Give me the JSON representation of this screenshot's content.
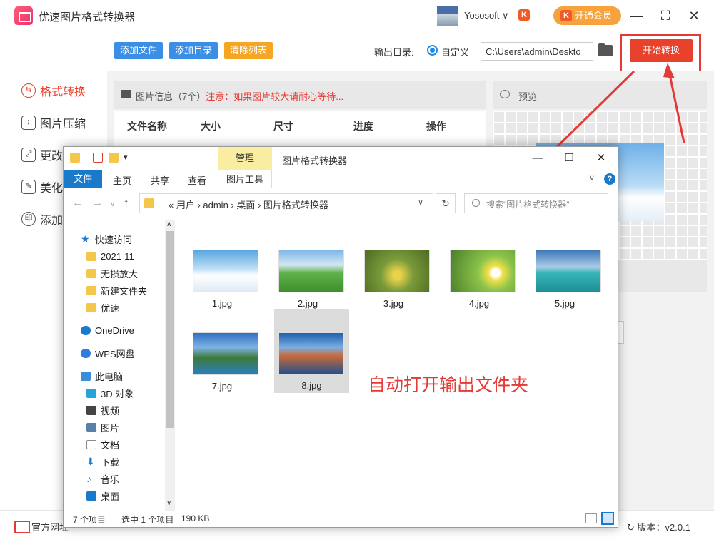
{
  "app": {
    "title": "优速图片格式转换器",
    "user_name": "Yososoft ∨",
    "user_badge": "K",
    "vip_label": "开通会员",
    "window_controls": [
      "—",
      "⛶",
      "✕"
    ]
  },
  "sidebar": {
    "items": [
      {
        "label": "格式转换",
        "icon": "convert-icon"
      },
      {
        "label": "图片压缩",
        "icon": "compress-icon"
      },
      {
        "label": "更改",
        "icon": "resize-icon"
      },
      {
        "label": "美化",
        "icon": "beautify-icon"
      },
      {
        "label": "添加",
        "icon": "watermark-icon"
      }
    ]
  },
  "toolbar": {
    "add_file": "添加文件",
    "add_dir": "添加目录",
    "clear_list": "清除列表",
    "output_label": "输出目录:",
    "radio_label": "自定义",
    "output_path": "C:\\Users\\admin\\Deskto",
    "start_label": "开始转换"
  },
  "panel": {
    "info_title": "图片信息（7个）",
    "info_note": "注意：如果图片较大请耐心等待...",
    "columns": [
      "文件名称",
      "大小",
      "尺寸",
      "进度",
      "操作"
    ],
    "preview_title": "预览"
  },
  "bottom": {
    "website": "官方网址",
    "version": "版本：v2.0.1"
  },
  "explorer": {
    "manage_label": "管理",
    "title": "图片格式转换器",
    "ribbon_tabs": [
      "文件",
      "主页",
      "共享",
      "查看",
      "图片工具"
    ],
    "help": "?",
    "address": "«  用户  ›  admin  ›  桌面  ›  图片格式转换器",
    "search_placeholder": "搜索\"图片格式转换器\"",
    "nav_items": [
      {
        "label": "快速访问",
        "icon": "star-icon",
        "color": "#1979ca"
      },
      {
        "label": "2021-11",
        "icon": "folder-icon",
        "color": "#f4c64a"
      },
      {
        "label": "无损放大",
        "icon": "folder-icon",
        "color": "#f4c64a"
      },
      {
        "label": "新建文件夹",
        "icon": "folder-icon",
        "color": "#f4c64a"
      },
      {
        "label": "优速",
        "icon": "folder-icon",
        "color": "#f4c64a"
      },
      {
        "label": "OneDrive",
        "icon": "cloud-icon",
        "color": "#1979ca"
      },
      {
        "label": "WPS网盘",
        "icon": "cloud-icon",
        "color": "#2b7de0"
      },
      {
        "label": "此电脑",
        "icon": "computer-icon",
        "color": "#3a8ed8"
      },
      {
        "label": "3D 对象",
        "icon": "cube-icon",
        "color": "#27a3d8"
      },
      {
        "label": "视频",
        "icon": "video-icon",
        "color": "#444"
      },
      {
        "label": "图片",
        "icon": "picture-icon",
        "color": "#5a7fa8"
      },
      {
        "label": "文档",
        "icon": "document-icon",
        "color": "#888"
      },
      {
        "label": "下载",
        "icon": "download-icon",
        "color": "#1979ca"
      },
      {
        "label": "音乐",
        "icon": "music-icon",
        "color": "#1979ca"
      },
      {
        "label": "桌面",
        "icon": "desktop-icon",
        "color": "#1979ca"
      }
    ],
    "files": [
      {
        "name": "1.jpg",
        "selected": false
      },
      {
        "name": "2.jpg",
        "selected": false
      },
      {
        "name": "3.jpg",
        "selected": false
      },
      {
        "name": "4.jpg",
        "selected": false
      },
      {
        "name": "5.jpg",
        "selected": false
      },
      {
        "name": "7.jpg",
        "selected": false
      },
      {
        "name": "8.jpg",
        "selected": true
      }
    ],
    "status_count": "7 个项目",
    "status_selected": "选中 1 个项目",
    "status_size": "190 KB"
  },
  "annotation": "自动打开输出文件夹",
  "colors": {
    "accent": "#e8412c",
    "blue_button": "#3a8ee6",
    "orange_button": "#f5a623",
    "vip": "#f8a23d",
    "explorer_blue": "#1979ca"
  }
}
